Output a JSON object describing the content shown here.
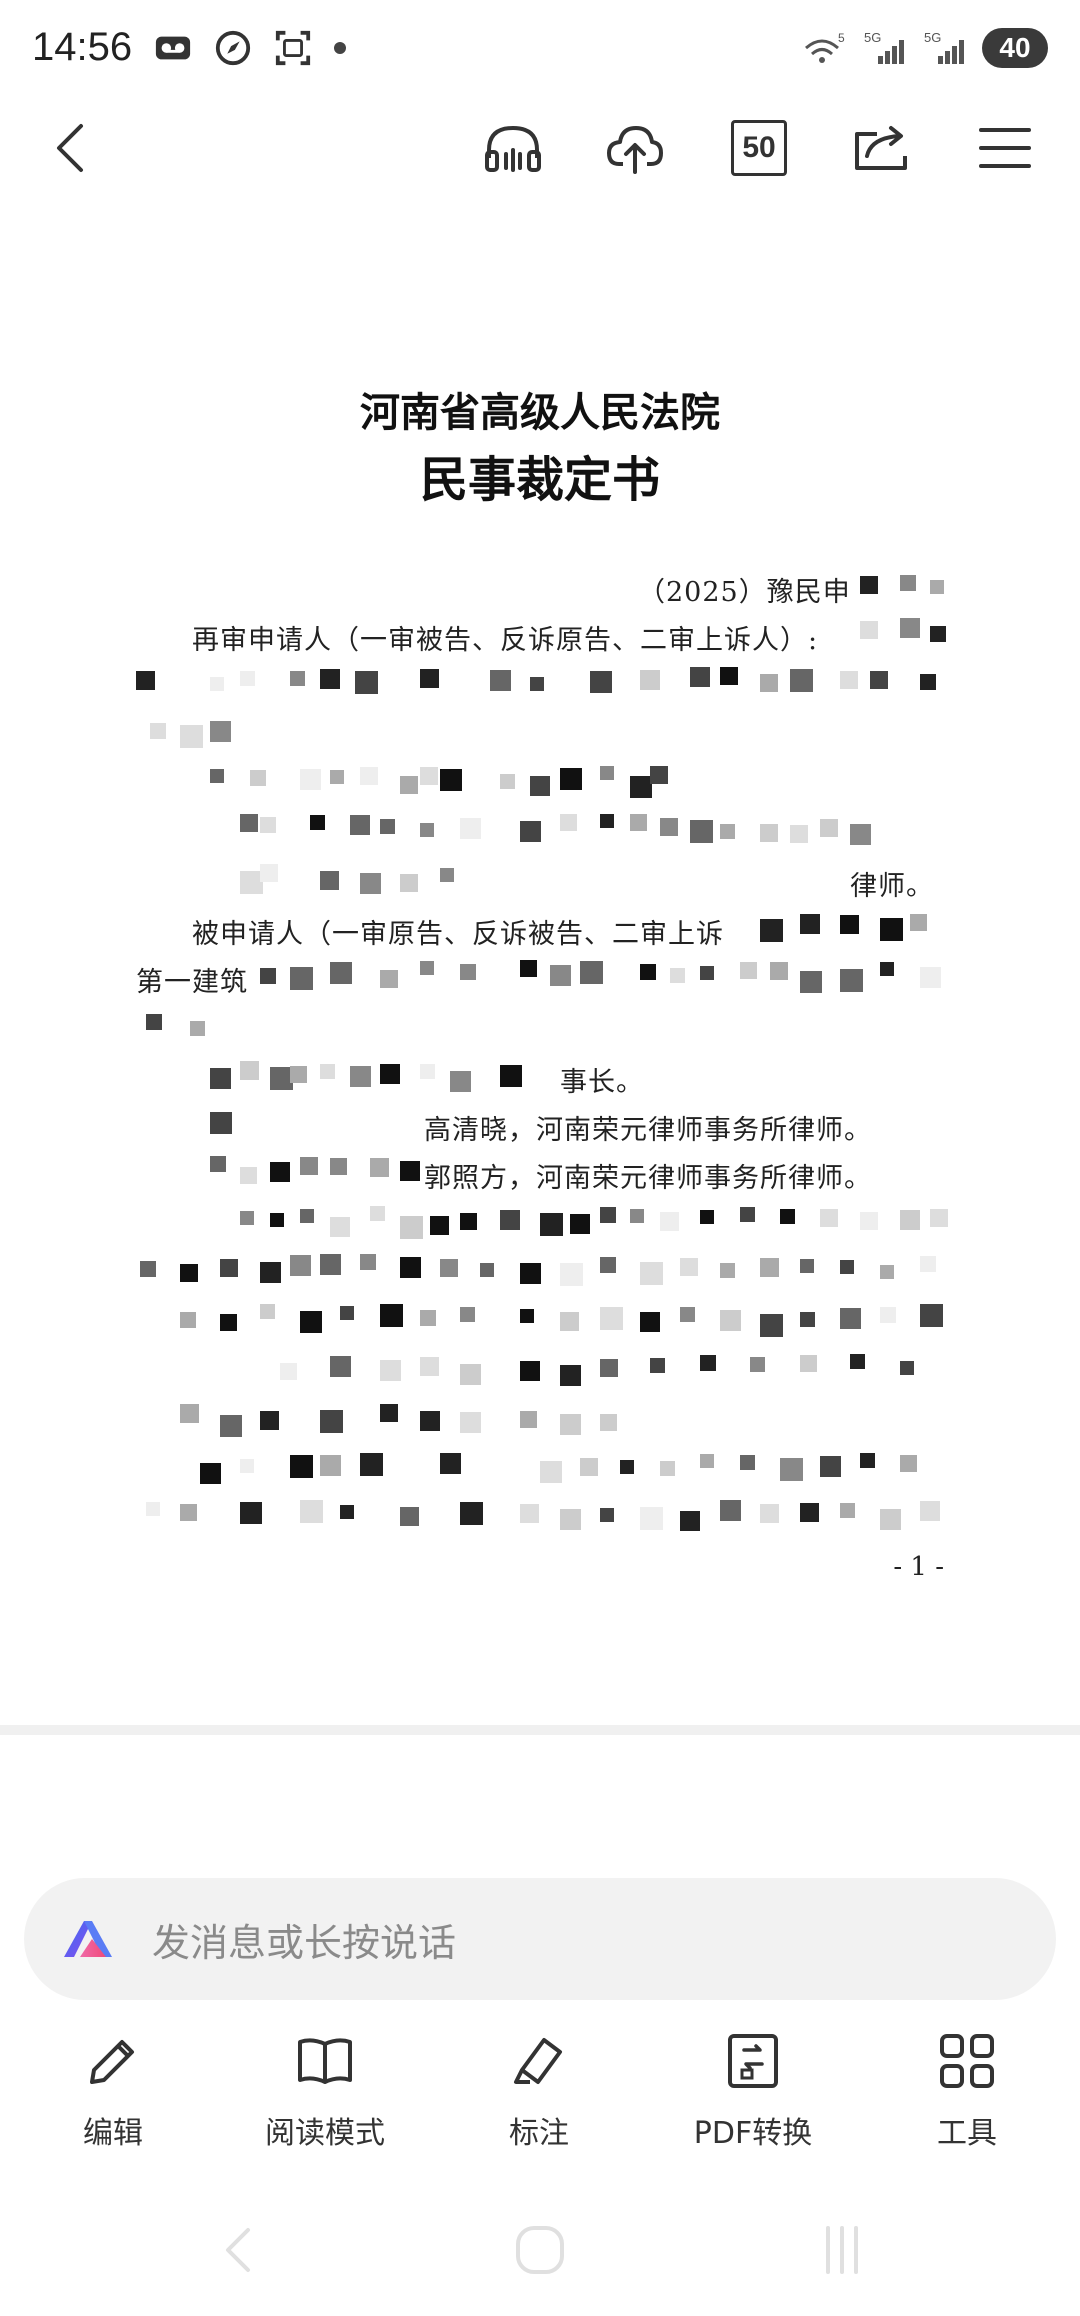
{
  "status_bar": {
    "time": "14:56",
    "signal_1": "5G",
    "signal_2": "5G",
    "wifi_label": "5",
    "battery": "40"
  },
  "toolbar": {
    "page_count": "50"
  },
  "document": {
    "title_court": "河南省高级人民法院",
    "title_doc": "民事裁定书",
    "case_no": "（2025）豫民申",
    "line_petitioner": "再审申请人（一审被告、反诉原告、二审上诉人）:",
    "line_respondent": "被申请人（一审原告、反诉被告、二审上诉",
    "line_company": "第一建筑",
    "line_lawyer_suffix": "律师。",
    "line_chairman": "事长。",
    "line_agent1": "高清晓，河南荣元律师事务所律师。",
    "line_agent2": "郭照方，河南荣元律师事务所律师。",
    "page_number": "- 1 -"
  },
  "input": {
    "placeholder": "发消息或长按说话"
  },
  "actions": [
    {
      "label": "编辑",
      "icon": "pencil-icon"
    },
    {
      "label": "阅读模式",
      "icon": "book-icon"
    },
    {
      "label": "标注",
      "icon": "highlighter-icon"
    },
    {
      "label": "PDF转换",
      "icon": "pdf-convert-icon"
    },
    {
      "label": "工具",
      "icon": "grid-tools-icon"
    }
  ]
}
